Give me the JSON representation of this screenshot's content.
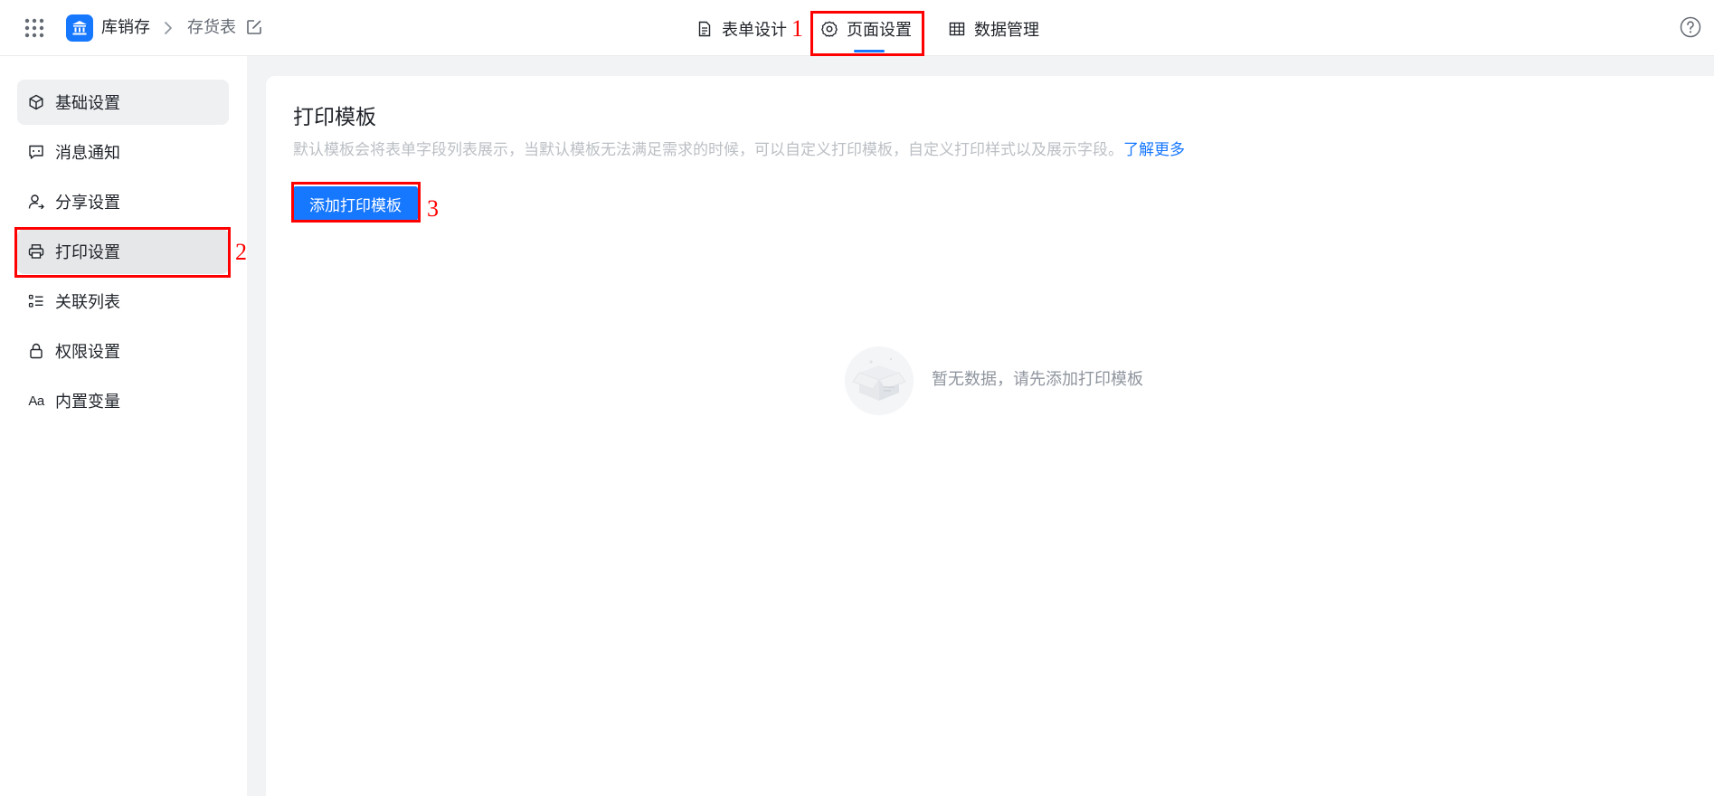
{
  "header": {
    "app_name": "库销存",
    "page_name": "存货表",
    "tabs": [
      {
        "label": "表单设计",
        "icon": "document-icon"
      },
      {
        "label": "页面设置",
        "icon": "gear-icon",
        "active": true
      },
      {
        "label": "数据管理",
        "icon": "table-grid-icon"
      }
    ]
  },
  "sidebar": {
    "items": [
      {
        "label": "基础设置",
        "icon": "cube-icon"
      },
      {
        "label": "消息通知",
        "icon": "message-icon"
      },
      {
        "label": "分享设置",
        "icon": "share-user-icon"
      },
      {
        "label": "打印设置",
        "icon": "printer-icon",
        "selected": true
      },
      {
        "label": "关联列表",
        "icon": "list-icon"
      },
      {
        "label": "权限设置",
        "icon": "lock-icon"
      },
      {
        "label": "内置变量",
        "icon": "aa-text-icon",
        "glyph": "Aa"
      }
    ]
  },
  "main": {
    "title": "打印模板",
    "description": "默认模板会将表单字段列表展示，当默认模板无法满足需求的时候，可以自定义打印模板，自定义打印样式以及展示字段。",
    "learn_more": "了解更多",
    "add_button": "添加打印模板",
    "empty_text": "暂无数据，请先添加打印模板"
  },
  "annotations": [
    "1",
    "2",
    "3"
  ],
  "colors": {
    "accent": "#1677ff",
    "annotation": "#ff0000",
    "background": "#f2f3f5"
  }
}
